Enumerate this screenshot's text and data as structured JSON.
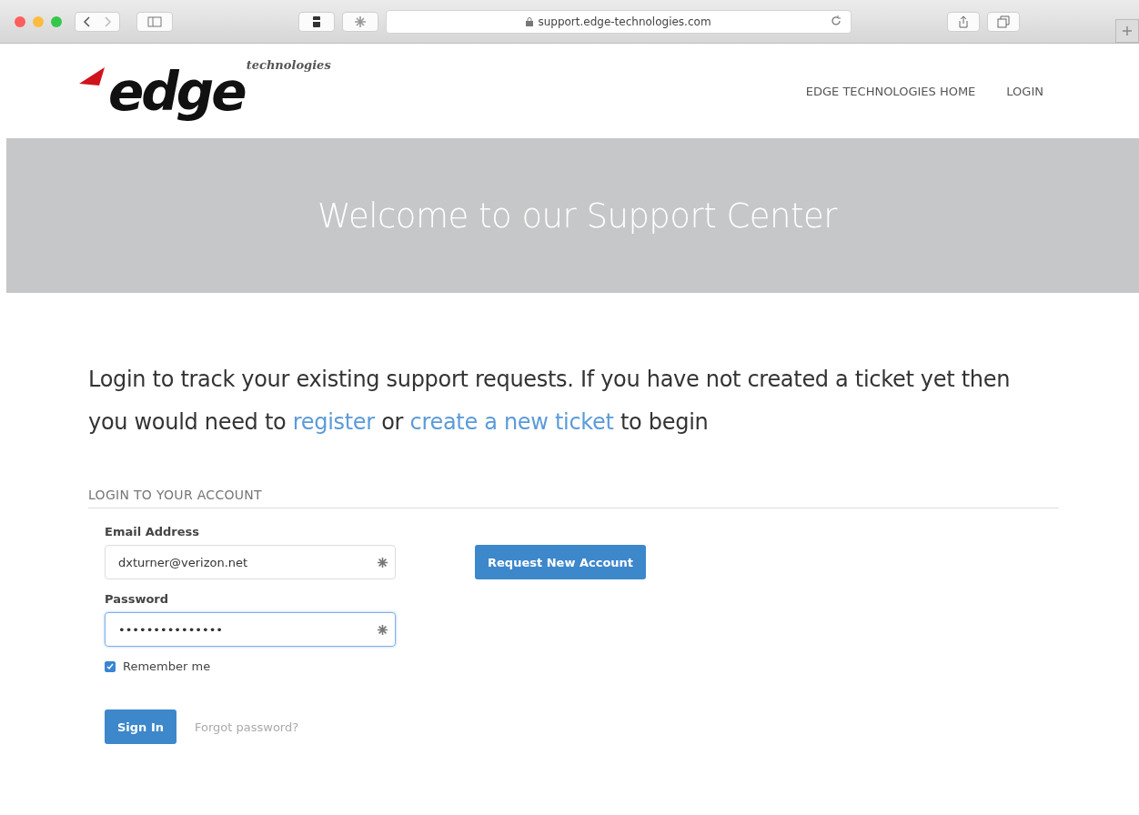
{
  "browser": {
    "url": "support.edge-technologies.com"
  },
  "header": {
    "logo": {
      "word": "edge",
      "tagline": "technologies"
    },
    "nav": [
      {
        "label": "EDGE TECHNOLOGIES HOME"
      },
      {
        "label": "LOGIN"
      }
    ]
  },
  "banner": {
    "title": "Welcome to our Support Center"
  },
  "intro": [
    {
      "kind": "text",
      "text": "Login to track your existing support requests. If you have not created a ticket yet then you would need to "
    },
    {
      "kind": "link",
      "text": "register"
    },
    {
      "kind": "text",
      "text": " or "
    },
    {
      "kind": "link",
      "text": "create a new ticket"
    },
    {
      "kind": "text",
      "text": " to begin"
    }
  ],
  "login": {
    "heading": "LOGIN TO YOUR ACCOUNT",
    "fields": [
      {
        "label": "Email Address",
        "value": "dxturner@verizon.net",
        "focused": false
      },
      {
        "label": "Password",
        "value": "•••••••••••••••",
        "focused": true
      }
    ],
    "remember": {
      "label": "Remember me",
      "checked": true
    },
    "sign_in": "Sign In",
    "forgot": "Forgot password?",
    "request_account": "Request New Account"
  }
}
